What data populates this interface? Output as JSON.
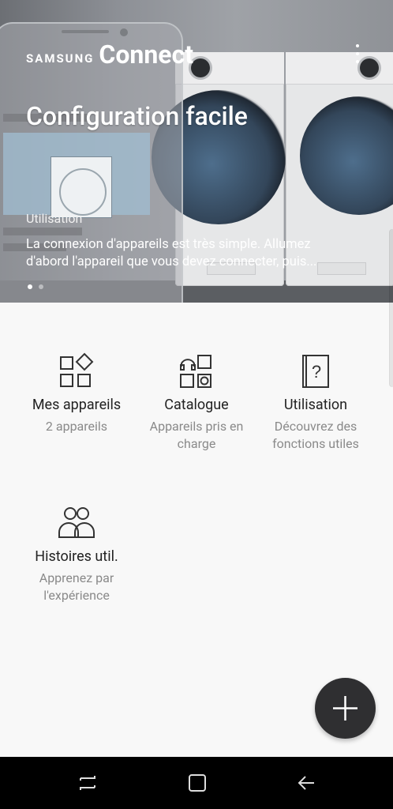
{
  "app": {
    "brand_small": "SAMSUNG",
    "brand_large": "Connect"
  },
  "hero": {
    "title": "Configuration facile",
    "category": "Utilisation",
    "description_line1": "La connexion d'appareils est très simple. Allumez",
    "description_line2": "d'abord l'appareil que vous devez connecter, puis...",
    "page_count": 2,
    "active_page": 1
  },
  "tiles": [
    {
      "id": "devices",
      "title": "Mes appareils",
      "subtitle_lines": [
        "2 appareils"
      ],
      "icon": "apps-grid-icon"
    },
    {
      "id": "catalog",
      "title": "Catalogue",
      "subtitle_lines": [
        "Appareils pris en",
        "charge"
      ],
      "icon": "catalog-icon"
    },
    {
      "id": "usage",
      "title": "Utilisation",
      "subtitle_lines": [
        "Découvrez des",
        "fonctions utiles"
      ],
      "icon": "help-book-icon"
    },
    {
      "id": "stories",
      "title": "Histoires util.",
      "subtitle_lines": [
        "Apprenez par",
        "l'expérience"
      ],
      "icon": "users-icon"
    }
  ],
  "fab": {
    "icon": "plus-icon"
  },
  "navbar": {
    "icons": [
      "recents-icon",
      "home-icon",
      "back-icon"
    ]
  },
  "colors": {
    "fab": "#2f2f31",
    "background": "#f8f8f8",
    "subtitle": "#8a8a8a"
  }
}
